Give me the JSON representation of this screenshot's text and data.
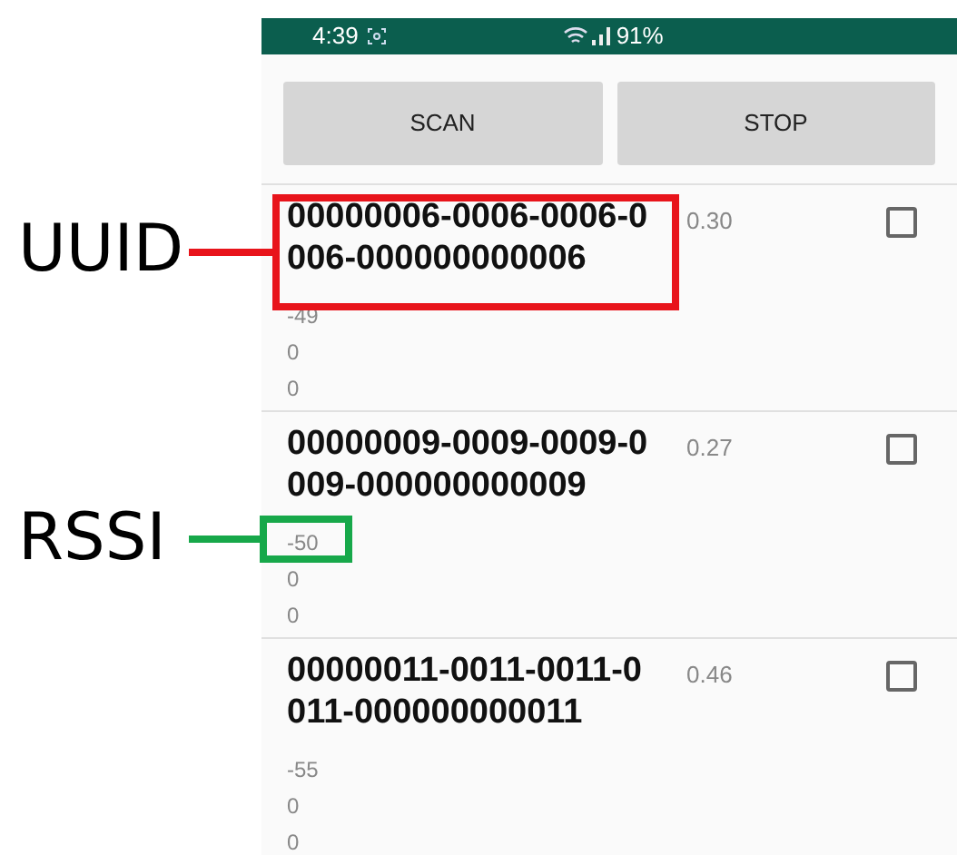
{
  "status_bar": {
    "time": "4:39",
    "battery": "91%"
  },
  "buttons": [
    "SCAN",
    "STOP"
  ],
  "devices": [
    {
      "uuid": "00000006-0006-0006-0006-000000000006",
      "distance": "0.30",
      "rssi": "-49",
      "line_3": "0",
      "line_4": "0",
      "checked": false
    },
    {
      "uuid": "00000009-0009-0009-0009-000000000009",
      "distance": "0.27",
      "rssi": "-50",
      "line_3": "0",
      "line_4": "0",
      "checked": false
    },
    {
      "uuid": "00000011-0011-0011-0011-000000000011",
      "distance": "0.46",
      "rssi": "-55",
      "line_3": "0",
      "line_4": "0",
      "checked": false
    }
  ],
  "annotations": [
    {
      "kind": "uuid",
      "label": "UUID",
      "color": "#e8141b"
    },
    {
      "kind": "rssi",
      "label": "RSSI",
      "color": "#17a84a"
    }
  ]
}
